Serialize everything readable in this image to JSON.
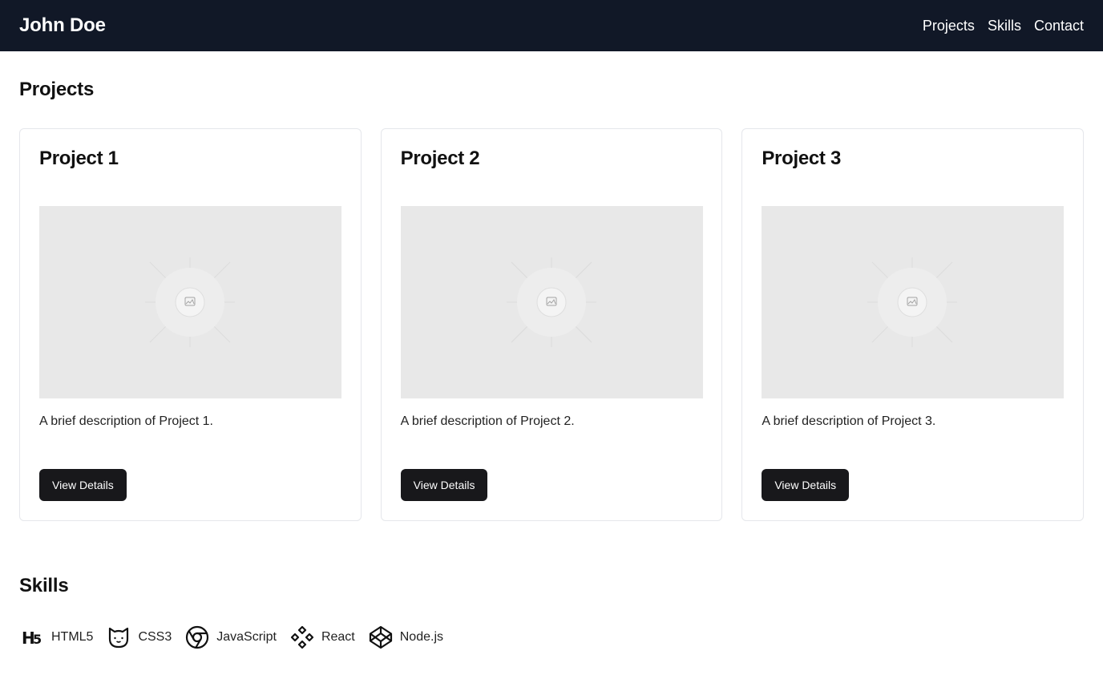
{
  "header": {
    "brand": "John Doe",
    "nav": [
      "Projects",
      "Skills",
      "Contact"
    ],
    "background": "#111827"
  },
  "projects": {
    "title": "Projects",
    "cards": [
      {
        "title": "Project 1",
        "description": "A brief description of Project 1.",
        "button": "View Details"
      },
      {
        "title": "Project 2",
        "description": "A brief description of Project 2.",
        "button": "View Details"
      },
      {
        "title": "Project 3",
        "description": "A brief description of Project 3.",
        "button": "View Details"
      }
    ]
  },
  "skills": {
    "title": "Skills",
    "items": [
      {
        "label": "HTML5",
        "icon": "html5-icon"
      },
      {
        "label": "CSS3",
        "icon": "css3-icon"
      },
      {
        "label": "JavaScript",
        "icon": "chrome-icon"
      },
      {
        "label": "React",
        "icon": "diamond-grid-icon"
      },
      {
        "label": "Node.js",
        "icon": "codepen-icon"
      }
    ]
  },
  "colors": {
    "button": "#18181b",
    "card_border": "#e5e7eb",
    "image_placeholder": "#e8e8e8"
  }
}
